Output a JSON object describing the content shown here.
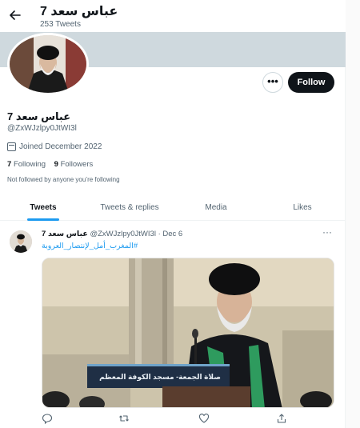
{
  "header": {
    "back_icon": "arrow-left-icon",
    "title": "7 عباس سعد",
    "tweet_count": "253 Tweets"
  },
  "profile": {
    "more_icon": "ellipsis-icon",
    "more_label": "•••",
    "follow_label": "Follow",
    "name": "7 عباس سعد",
    "handle": "@ZxWJzlpy0JtWI3l",
    "joined": "Joined December 2022",
    "following_count": "7",
    "following_label": "Following",
    "followers_count": "9",
    "followers_label": "Followers",
    "not_followed_text": "Not followed by anyone you’re following"
  },
  "tabs": [
    {
      "label": "Tweets"
    },
    {
      "label": "Tweets & replies"
    },
    {
      "label": "Media"
    },
    {
      "label": "Likes"
    }
  ],
  "tweet": {
    "author_name": "7 عباس سعد",
    "author_handle": "@ZxWJzlpy0JtWI3l",
    "date": "· Dec 6",
    "more_label": "···",
    "text": "#المغرب_أمل_لإنتصار_العروبة",
    "media_caption": "صلاة الجمعة- مسجد الكوفة المعظم",
    "actions": {
      "reply_icon": "reply-icon",
      "retweet_icon": "retweet-icon",
      "like_icon": "heart-icon",
      "share_icon": "share-icon"
    }
  },
  "colors": {
    "accent": "#1d9bf0",
    "text": "#0f1419",
    "muted": "#536471",
    "banner": "#cfd9de",
    "scarf": "#2e9b5e"
  }
}
